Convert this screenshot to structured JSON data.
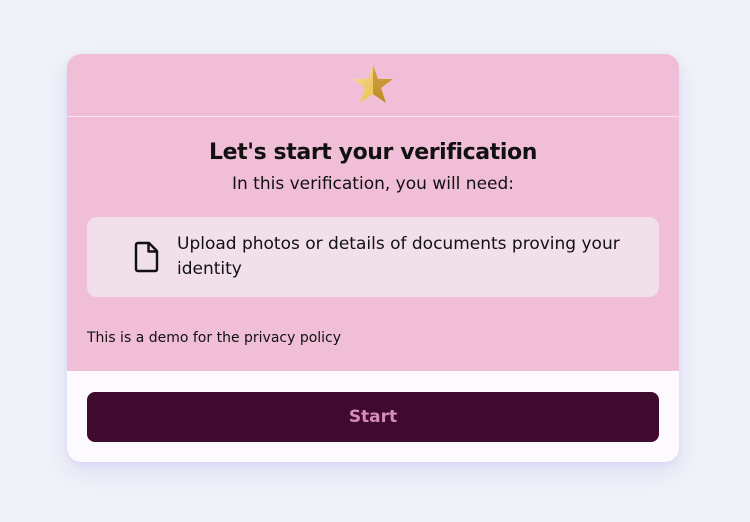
{
  "header": {
    "icon": "star-icon"
  },
  "main": {
    "title": "Let's start your verification",
    "subtitle": "In this verification, you will need:",
    "requirements": [
      {
        "icon": "document-icon",
        "text": "Upload photos or details of documents proving your identity"
      }
    ],
    "privacy_text": "This is a demo for the privacy policy"
  },
  "footer": {
    "start_label": "Start"
  },
  "colors": {
    "page_background": "#f0f3f8",
    "card_background": "#f0bed7",
    "requirement_background": "#f1dfea",
    "footer_background": "#fdfaff",
    "button_background": "#3e0a2d",
    "button_text": "#d68bbd",
    "star_gold": "#e7b93c"
  }
}
